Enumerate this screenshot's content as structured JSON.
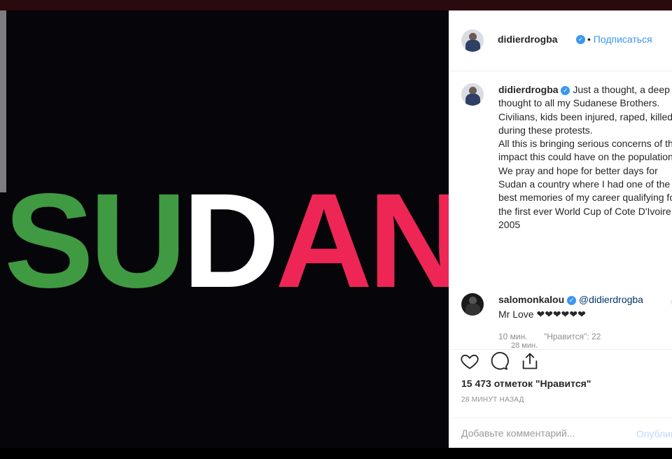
{
  "post_image": {
    "letters": [
      {
        "char": "S",
        "color": "#3f9a42"
      },
      {
        "char": "U",
        "color": "#3f9a42"
      },
      {
        "char": "D",
        "color": "#ffffff"
      },
      {
        "char": "A",
        "color": "#ee2656"
      },
      {
        "char": "N",
        "color": "#ee2656"
      }
    ],
    "background": "#06050a"
  },
  "header": {
    "username": "didierdrogba",
    "verified_icon": "verified-badge-icon",
    "separator": "•",
    "follow_label": "Подписаться"
  },
  "caption": {
    "username": "didierdrogba",
    "text": " Just a thought, a deep thought to all my Sudanese Brothers.\nCivilians, kids been injured, raped, killed during these protests.\nAll this is bringing serious concerns of the impact this could have on the population.\nWe pray and hope for better days for Sudan a country where I had one of the best memories of my career qualifying for the first ever World Cup of Cote D'Ivoire in 2005",
    "time": "28 мин."
  },
  "comment": {
    "username": "salomonkalou",
    "mention": "@didierdrogba",
    "text": "Mr Love ❤❤❤❤❤❤",
    "time": "10 мин.",
    "likes": "\"Нравится\": 22"
  },
  "actions": {
    "like_icon": "heart-icon",
    "comment_icon": "comment-bubble-icon",
    "share_icon": "share-upload-icon"
  },
  "likes_count": "15 473 отметок \"Нравится\"",
  "posted_ago": "28 МИНУТ НАЗАД",
  "comment_box": {
    "placeholder": "Добавьте комментарий...",
    "publish_label": "Опубликовать"
  },
  "colors": {
    "accent": "#3897f0",
    "secondary_text": "#8e8e8e"
  }
}
